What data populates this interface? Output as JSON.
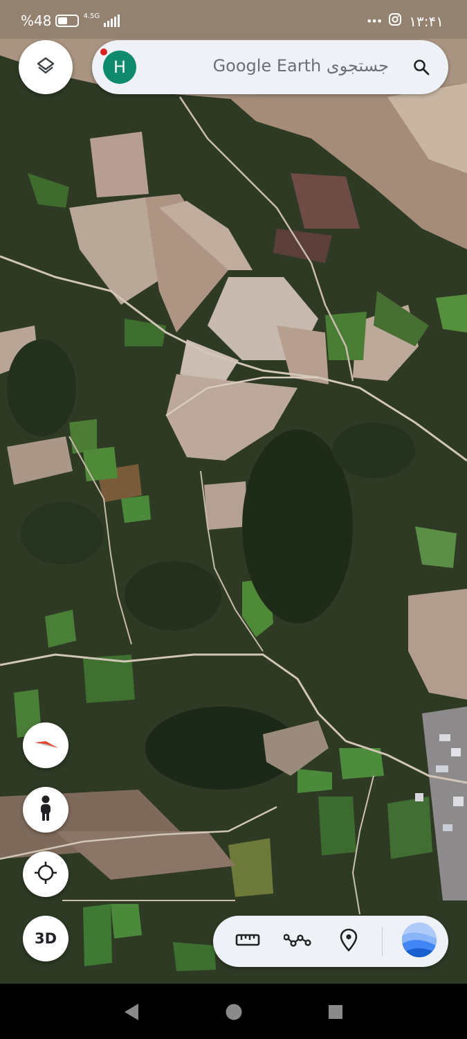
{
  "status_bar": {
    "battery_text": "%48",
    "battery_level": 0.48,
    "network_label": "4.5G",
    "time": "۱۳:۴۱",
    "overflow": "•••",
    "icons": [
      "battery-icon",
      "signal-icon",
      "instagram-icon",
      "more-dots-icon"
    ]
  },
  "search": {
    "avatar_initial": "H",
    "placeholder": "جستجوی Google Earth",
    "icons": [
      "search-icon"
    ]
  },
  "left_controls": {
    "layers_icon": "layers-icon",
    "compass_icon": "compass-icon",
    "pegman_icon": "pegman-icon",
    "locate_icon": "my-location-icon",
    "three_d_label": "3D"
  },
  "toolbar": {
    "icons": [
      "ruler-icon",
      "draw-path-icon",
      "place-pin-icon",
      "google-earth-logo"
    ]
  },
  "nav": {
    "icons": [
      "back-icon",
      "home-icon",
      "recents-icon"
    ]
  },
  "colors": {
    "accent_avatar": "#0f8a6c",
    "notification_dot": "#dd2222",
    "bar_bg": "#eef1f6",
    "compass_red": "#e2452c"
  }
}
